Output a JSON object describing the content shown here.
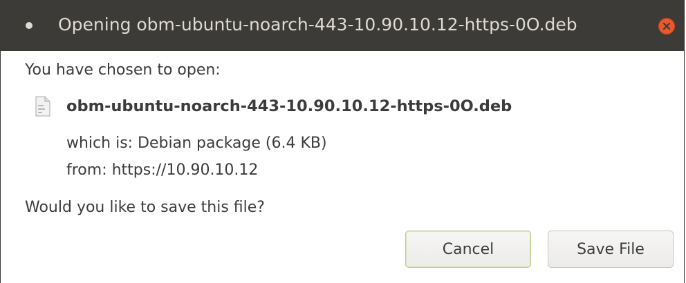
{
  "window": {
    "title": "Opening obm-ubuntu-noarch-443-10.90.10.12-https-0O.deb",
    "close_icon": "close-icon",
    "close_color": "#e7592f",
    "titlebar_color": "#3c3b37"
  },
  "content": {
    "prompt": "You have chosen to open:",
    "file_icon": "file-icon",
    "file_name": "obm-ubuntu-noarch-443-10.90.10.12-https-0O.deb",
    "which_is": "which is:  Debian package (6.4 KB)",
    "from": "from:  https://10.90.10.12",
    "question": "Would you like to save this file?"
  },
  "buttons": {
    "cancel_label": "Cancel",
    "save_label": "Save File"
  }
}
